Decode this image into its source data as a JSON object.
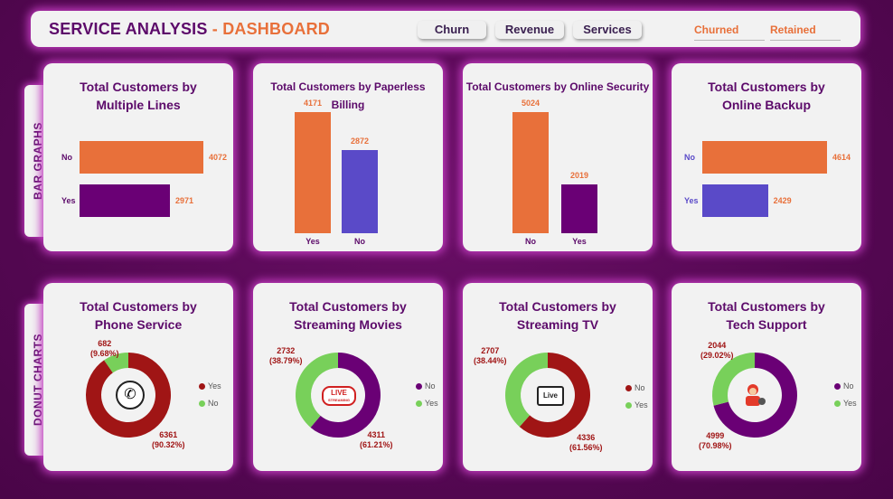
{
  "header": {
    "title_part1": "SERVICE ANALYSIS",
    "title_sep": " - ",
    "title_part2": "DASHBOARD",
    "nav": [
      "Churn",
      "Revenue",
      "Services"
    ],
    "filters": [
      "Churned",
      "Retained"
    ]
  },
  "side_labels": {
    "bars": "BAR GRAPHS",
    "donuts": "DONUT CHARTS"
  },
  "colors": {
    "orange": "#e8703a",
    "purple": "#6a0075",
    "blue": "#5a4ac8",
    "red": "#a01515",
    "green": "#78d05a"
  },
  "icons": {
    "phone": "phone-icon",
    "movies": "live-streaming-icon",
    "tv": "tv-icon",
    "tech": "technician-icon"
  },
  "chart_data": [
    {
      "type": "bar",
      "orientation": "horizontal",
      "title": "Total Customers by Multiple Lines",
      "categories": [
        "No",
        "Yes"
      ],
      "values": [
        4072,
        2971
      ]
    },
    {
      "type": "bar",
      "orientation": "vertical",
      "title": "Total Customers by Paperless Billing",
      "categories": [
        "Yes",
        "No"
      ],
      "values": [
        4171,
        2872
      ]
    },
    {
      "type": "bar",
      "orientation": "vertical",
      "title": "Total Customers by Online Security",
      "categories": [
        "No",
        "Yes"
      ],
      "values": [
        5024,
        2019
      ]
    },
    {
      "type": "bar",
      "orientation": "horizontal",
      "title": "Total Customers by Online Backup",
      "categories": [
        "No",
        "Yes"
      ],
      "values": [
        4614,
        2429
      ]
    },
    {
      "type": "pie",
      "variant": "donut",
      "title": "Total Customers by Phone Service",
      "categories": [
        "Yes",
        "No"
      ],
      "values": [
        6361,
        682
      ],
      "labels": [
        "6361\n(90.32%)",
        "682\n(9.68%)"
      ],
      "legend": [
        "Yes",
        "No"
      ]
    },
    {
      "type": "pie",
      "variant": "donut",
      "title": "Total Customers by Streaming Movies",
      "categories": [
        "No",
        "Yes"
      ],
      "values": [
        4311,
        2732
      ],
      "labels": [
        "4311\n(61.21%)",
        "2732\n(38.79%)"
      ],
      "legend": [
        "No",
        "Yes"
      ]
    },
    {
      "type": "pie",
      "variant": "donut",
      "title": "Total Customers by Streaming TV",
      "categories": [
        "No",
        "Yes"
      ],
      "values": [
        4336,
        2707
      ],
      "labels": [
        "4336\n(61.56%)",
        "2707\n(38.44%)"
      ],
      "legend": [
        "No",
        "Yes"
      ]
    },
    {
      "type": "pie",
      "variant": "donut",
      "title": "Total Customers by Tech Support",
      "categories": [
        "No",
        "Yes"
      ],
      "values": [
        4999,
        2044
      ],
      "labels": [
        "4999\n(70.98%)",
        "2044\n(29.02%)"
      ],
      "legend": [
        "No",
        "Yes"
      ]
    }
  ],
  "cards": {
    "ml": {
      "title_l1": "Total Customers by",
      "title_l2": "Multiple Lines",
      "cats": [
        "No",
        "Yes"
      ],
      "vals": [
        "4072",
        "2971"
      ]
    },
    "pb": {
      "title": "Total Customers by Paperless Billing",
      "cats": [
        "Yes",
        "No"
      ],
      "vals": [
        "4171",
        "2872"
      ]
    },
    "os": {
      "title": "Total Customers by Online Security",
      "cats": [
        "No",
        "Yes"
      ],
      "vals": [
        "5024",
        "2019"
      ]
    },
    "ob": {
      "title_l1": "Total Customers by",
      "title_l2": "Online Backup",
      "cats": [
        "No",
        "Yes"
      ],
      "vals": [
        "4614",
        "2429"
      ]
    },
    "ps": {
      "title_l1": "Total Customers by",
      "title_l2": "Phone Service",
      "big_v": "6361",
      "big_p": "(90.32%)",
      "small_v": "682",
      "small_p": "(9.68%)",
      "leg": [
        "Yes",
        "No"
      ]
    },
    "sm": {
      "title_l1": "Total Customers by",
      "title_l2": "Streaming Movies",
      "big_v": "4311",
      "big_p": "(61.21%)",
      "small_v": "2732",
      "small_p": "(38.79%)",
      "leg": [
        "No",
        "Yes"
      ]
    },
    "st": {
      "title_l1": "Total Customers by",
      "title_l2": "Streaming TV",
      "big_v": "4336",
      "big_p": "(61.56%)",
      "small_v": "2707",
      "small_p": "(38.44%)",
      "leg": [
        "No",
        "Yes"
      ]
    },
    "ts": {
      "title_l1": "Total Customers by",
      "title_l2": "Tech Support",
      "big_v": "4999",
      "big_p": "(70.98%)",
      "small_v": "2044",
      "small_p": "(29.02%)",
      "leg": [
        "No",
        "Yes"
      ]
    }
  },
  "live_icon_text": "LIVE",
  "live_icon_sub": "STREAMING",
  "tv_icon_text": "Live"
}
